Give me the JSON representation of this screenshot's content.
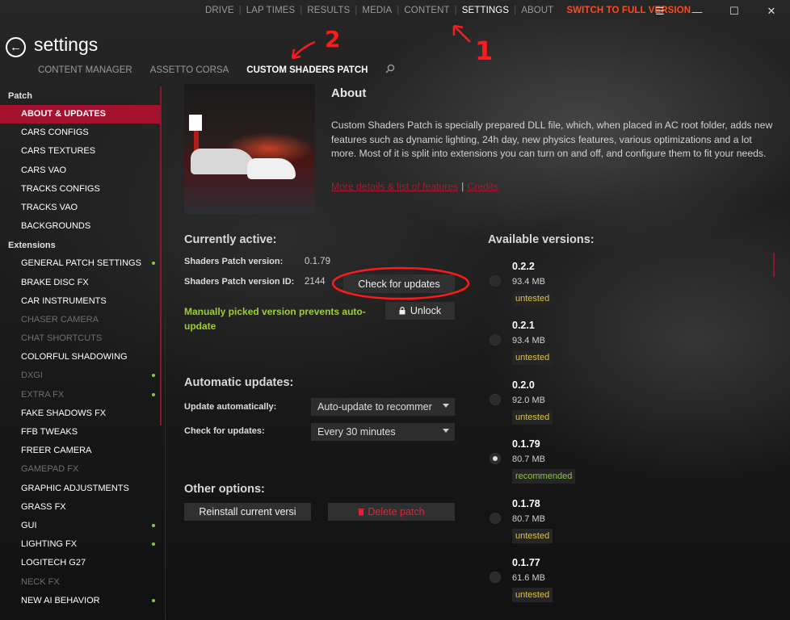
{
  "topnav": {
    "items": [
      "DRIVE",
      "LAP TIMES",
      "RESULTS",
      "MEDIA",
      "CONTENT",
      "SETTINGS",
      "ABOUT"
    ],
    "full_version": "SWITCH TO FULL VERSION"
  },
  "window": {
    "menu": "☰",
    "minimize": "—",
    "maximize": "☐",
    "close": "✕"
  },
  "header": {
    "title": "settings",
    "back": "←"
  },
  "subtabs": [
    "CONTENT MANAGER",
    "ASSETTO CORSA",
    "CUSTOM SHADERS PATCH"
  ],
  "sidebar": {
    "group_patch": "Patch",
    "patch_items": [
      "ABOUT & UPDATES",
      "CARS CONFIGS",
      "CARS TEXTURES",
      "CARS VAO",
      "TRACKS CONFIGS",
      "TRACKS VAO",
      "BACKGROUNDS"
    ],
    "group_ext": "Extensions",
    "ext_items": [
      "GENERAL PATCH SETTINGS",
      "BRAKE DISC FX",
      "CAR INSTRUMENTS",
      "CHASER CAMERA",
      "CHAT SHORTCUTS",
      "COLORFUL SHADOWING",
      "DXGI",
      "EXTRA FX",
      "FAKE SHADOWS FX",
      "FFB TWEAKS",
      "FREER CAMERA",
      "GAMEPAD FX",
      "GRAPHIC ADJUSTMENTS",
      "GRASS FX",
      "GUI",
      "LIGHTING FX",
      "LOGITECH G27",
      "NECK FX",
      "NEW AI BEHAVIOR"
    ]
  },
  "about": {
    "heading": "About",
    "text": "Custom Shaders Patch is specially prepared DLL file, which, when placed in AC root folder, adds new features such as dynamic lighting, 24h day, new physics features, various optimizations and a lot more. Most of it is split into extensions you can turn on and off, and configure them to fit your needs.",
    "link_details": "More details & list of features",
    "link_credits": "Credits"
  },
  "current": {
    "heading": "Currently active:",
    "version_label": "Shaders Patch version:",
    "version_value": "0.1.79",
    "id_label": "Shaders Patch version ID:",
    "id_value": "2144",
    "check_button": "Check for updates",
    "warning": "Manually picked version prevents auto-update",
    "unlock_button": "Unlock"
  },
  "auto": {
    "heading": "Automatic updates:",
    "update_label": "Update automatically:",
    "update_value": "Auto-update to recommer",
    "check_label": "Check for updates:",
    "check_value": "Every 30 minutes"
  },
  "other": {
    "heading": "Other options:",
    "reinstall": "Reinstall current versi",
    "delete": "Delete patch"
  },
  "versions": {
    "heading": "Available versions:",
    "list": [
      {
        "name": "0.2.2",
        "size": "93.4 MB",
        "tag": "untested"
      },
      {
        "name": "0.2.1",
        "size": "93.4 MB",
        "tag": "untested"
      },
      {
        "name": "0.2.0",
        "size": "92.0 MB",
        "tag": "untested"
      },
      {
        "name": "0.1.79",
        "size": "80.7 MB",
        "tag": "recommended"
      },
      {
        "name": "0.1.78",
        "size": "80.7 MB",
        "tag": "untested"
      },
      {
        "name": "0.1.77",
        "size": "61.6 MB",
        "tag": "untested"
      }
    ]
  },
  "annotations": {
    "one": "1",
    "two": "2"
  },
  "colors": {
    "accent": "#a4122e",
    "full_version": "#ff4a1c",
    "warning": "#9bd02c",
    "untested": "#e1c435",
    "recommended": "#8bc34a",
    "annotation": "#ff1a1a"
  }
}
